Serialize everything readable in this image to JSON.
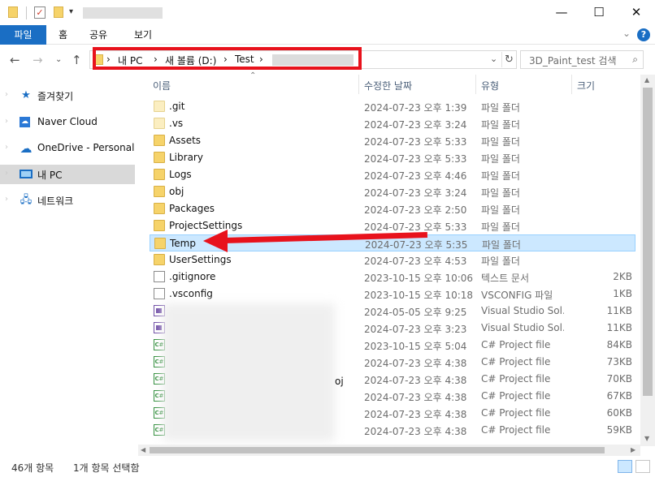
{
  "window": {
    "controls": {
      "minimize": "—",
      "maximize": "☐",
      "close": "✕"
    }
  },
  "ribbon": {
    "tabs": [
      "파일",
      "홈",
      "공유",
      "보기"
    ],
    "collapse": "⌄",
    "help": "?"
  },
  "address": {
    "crumbs": [
      "내 PC",
      "새 볼륨 (D:)",
      "Test"
    ],
    "separator": "›",
    "search_placeholder": "3D_Paint_test 검색"
  },
  "nav_pane": {
    "items": [
      {
        "label": "즐겨찾기",
        "icon": "star-icon",
        "color": "#1a6ec4"
      },
      {
        "label": "Naver Cloud",
        "icon": "naver-cloud-icon",
        "color": "#2b79d6"
      },
      {
        "label": "OneDrive - Personal",
        "icon": "onedrive-icon",
        "color": "#1a6ec4"
      },
      {
        "label": "내 PC",
        "icon": "computer-icon",
        "color": "#1a6ec4",
        "active": true
      },
      {
        "label": "네트워크",
        "icon": "network-icon",
        "color": "#1a6ec4"
      }
    ]
  },
  "columns": [
    "이름",
    "수정한 날짜",
    "유형",
    "크기"
  ],
  "files": [
    {
      "name": ".git",
      "date": "2024-07-23 오후 1:39",
      "type": "파일 폴더",
      "size": "",
      "icon": "folder-pale"
    },
    {
      "name": ".vs",
      "date": "2024-07-23 오후 3:24",
      "type": "파일 폴더",
      "size": "",
      "icon": "folder-pale"
    },
    {
      "name": "Assets",
      "date": "2024-07-23 오후 5:33",
      "type": "파일 폴더",
      "size": "",
      "icon": "folder"
    },
    {
      "name": "Library",
      "date": "2024-07-23 오후 5:33",
      "type": "파일 폴더",
      "size": "",
      "icon": "folder"
    },
    {
      "name": "Logs",
      "date": "2024-07-23 오후 4:46",
      "type": "파일 폴더",
      "size": "",
      "icon": "folder"
    },
    {
      "name": "obj",
      "date": "2024-07-23 오후 3:24",
      "type": "파일 폴더",
      "size": "",
      "icon": "folder"
    },
    {
      "name": "Packages",
      "date": "2024-07-23 오후 2:50",
      "type": "파일 폴더",
      "size": "",
      "icon": "folder"
    },
    {
      "name": "ProjectSettings",
      "date": "2024-07-23 오후 5:33",
      "type": "파일 폴더",
      "size": "",
      "icon": "folder"
    },
    {
      "name": "Temp",
      "date": "2024-07-23 오후 5:35",
      "type": "파일 폴더",
      "size": "",
      "icon": "folder",
      "selected": true
    },
    {
      "name": "UserSettings",
      "date": "2024-07-23 오후 4:53",
      "type": "파일 폴더",
      "size": "",
      "icon": "folder"
    },
    {
      "name": ".gitignore",
      "date": "2023-10-15 오후 10:06",
      "type": "텍스트 문서",
      "size": "2KB",
      "icon": "doc"
    },
    {
      "name": ".vsconfig",
      "date": "2023-10-15 오후 10:18",
      "type": "VSCONFIG 파일",
      "size": "1KB",
      "icon": "doc"
    },
    {
      "name": "",
      "date": "2024-05-05 오후 9:25",
      "type": "Visual Studio Sol...",
      "size": "11KB",
      "icon": "sln"
    },
    {
      "name": "",
      "date": "2024-07-23 오후 3:23",
      "type": "Visual Studio Sol...",
      "size": "11KB",
      "icon": "sln"
    },
    {
      "name": "",
      "date": "2023-10-15 오후 5:04",
      "type": "C# Project file",
      "size": "84KB",
      "icon": "cs"
    },
    {
      "name": "",
      "date": "2024-07-23 오후 4:38",
      "type": "C# Project file",
      "size": "73KB",
      "icon": "cs"
    },
    {
      "name": "",
      "date": "2024-07-23 오후 4:38",
      "type": "C# Project file",
      "size": "70KB",
      "icon": "cs"
    },
    {
      "name": "",
      "date": "2024-07-23 오후 4:38",
      "type": "C# Project file",
      "size": "67KB",
      "icon": "cs"
    },
    {
      "name": "",
      "date": "2024-07-23 오후 4:38",
      "type": "C# Project file",
      "size": "60KB",
      "icon": "cs"
    },
    {
      "name": "",
      "date": "2024-07-23 오후 4:38",
      "type": "C# Project file",
      "size": "59KB",
      "icon": "cs"
    }
  ],
  "blur_suffix": "oj",
  "status": {
    "count": "46개 항목",
    "selection": "1개 항목 선택함"
  },
  "colors": {
    "accent": "#1a6ec4",
    "selection": "#cce8ff",
    "annotation_red": "#e8121c"
  }
}
